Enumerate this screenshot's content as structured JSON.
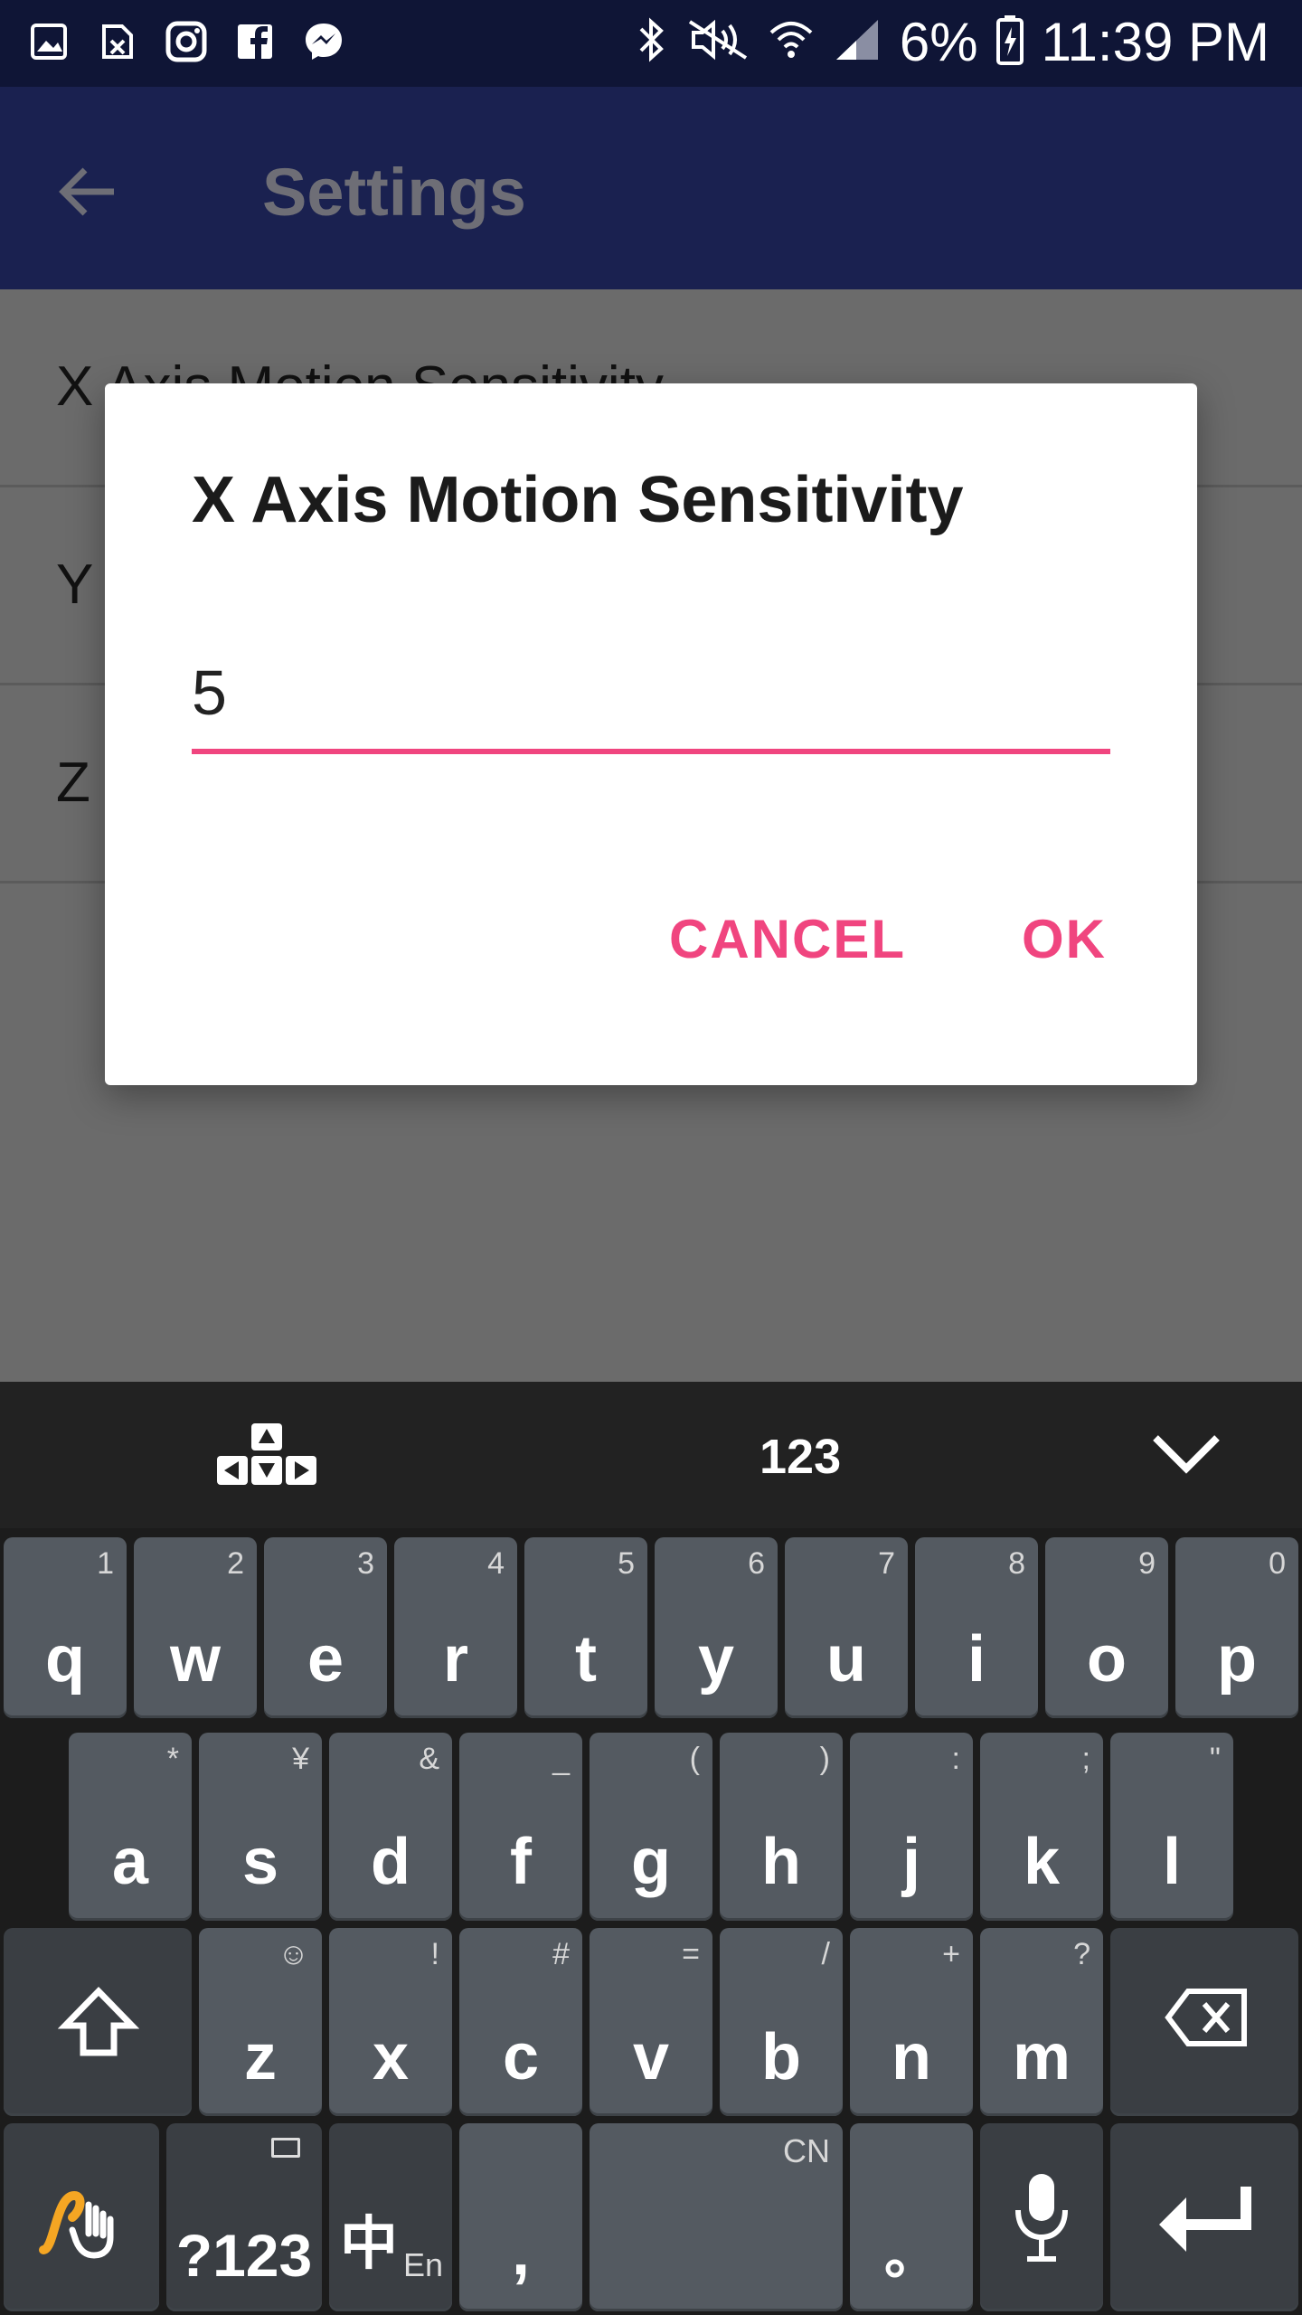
{
  "status_bar": {
    "left_icons": [
      "gallery-icon",
      "sim-icon",
      "instagram-icon",
      "facebook-icon",
      "messenger-icon"
    ],
    "right_icons": [
      "bluetooth-icon",
      "mute-icon",
      "wifi-icon",
      "signal-icon"
    ],
    "battery": "6%",
    "time": "11:39 PM"
  },
  "app_bar": {
    "title": "Settings",
    "back_icon": "arrow-left-icon"
  },
  "settings_list": {
    "items": [
      {
        "label": "X Axis Motion Sensitivity"
      },
      {
        "label": "Y"
      },
      {
        "label": "Z"
      }
    ]
  },
  "dialog": {
    "title": "X Axis Motion Sensitivity",
    "input_value": "5",
    "cancel_label": "CANCEL",
    "ok_label": "OK"
  },
  "keyboard": {
    "toolbar": {
      "arrows_icon": "cursor-arrows-icon",
      "numbers_label": "123",
      "collapse_icon": "chevron-down-icon"
    },
    "row1": [
      {
        "key": "q",
        "hint": "1"
      },
      {
        "key": "w",
        "hint": "2"
      },
      {
        "key": "e",
        "hint": "3"
      },
      {
        "key": "r",
        "hint": "4"
      },
      {
        "key": "t",
        "hint": "5"
      },
      {
        "key": "y",
        "hint": "6"
      },
      {
        "key": "u",
        "hint": "7"
      },
      {
        "key": "i",
        "hint": "8"
      },
      {
        "key": "o",
        "hint": "9"
      },
      {
        "key": "p",
        "hint": "0"
      }
    ],
    "row2": [
      {
        "key": "a",
        "hint": "*"
      },
      {
        "key": "s",
        "hint": "¥"
      },
      {
        "key": "d",
        "hint": "&"
      },
      {
        "key": "f",
        "hint": "_"
      },
      {
        "key": "g",
        "hint": "("
      },
      {
        "key": "h",
        "hint": ")"
      },
      {
        "key": "j",
        "hint": ":"
      },
      {
        "key": "k",
        "hint": ";"
      },
      {
        "key": "l",
        "hint": "\""
      }
    ],
    "row3": [
      {
        "key": "z",
        "hint": "☺"
      },
      {
        "key": "x",
        "hint": "!"
      },
      {
        "key": "c",
        "hint": "#"
      },
      {
        "key": "v",
        "hint": "="
      },
      {
        "key": "b",
        "hint": "/"
      },
      {
        "key": "n",
        "hint": "+"
      },
      {
        "key": "m",
        "hint": "?"
      }
    ],
    "row4": {
      "swipe_icon": "swype-hand-icon",
      "symbols_label": "?123",
      "lang_label": "中",
      "lang_sub": "En",
      "comma_label": ",",
      "space_hint": "CN",
      "period_label": "。",
      "mic_icon": "microphone-icon",
      "enter_icon": "enter-icon"
    },
    "shift_icon": "shift-icon",
    "backspace_icon": "backspace-icon"
  }
}
